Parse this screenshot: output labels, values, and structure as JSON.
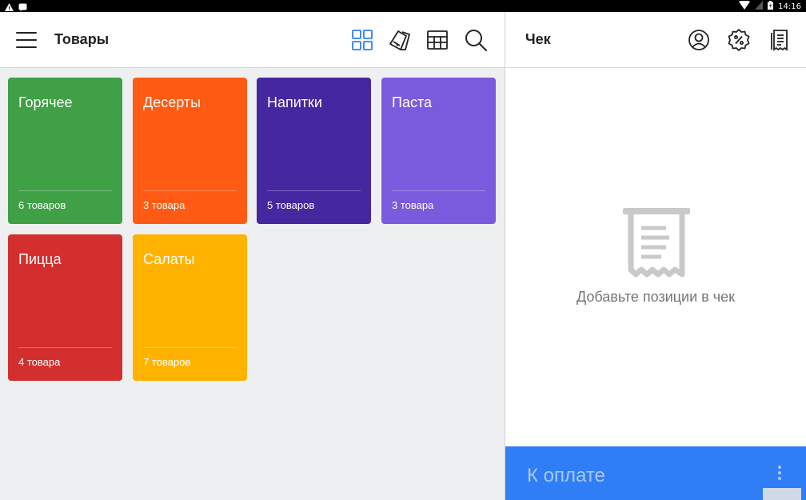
{
  "status_bar": {
    "time": "14:16"
  },
  "left": {
    "title": "Товары",
    "icons": [
      "menu-icon",
      "grid-icon",
      "palette-icon",
      "table-icon",
      "search-icon"
    ]
  },
  "categories": [
    {
      "name": "Горячее",
      "count": "6 товаров",
      "color": "#3fa046"
    },
    {
      "name": "Десерты",
      "count": "3 товара",
      "color": "#ff5b14"
    },
    {
      "name": "Напитки",
      "count": "5 товаров",
      "color": "#4527a0"
    },
    {
      "name": "Паста",
      "count": "3 товара",
      "color": "#7b5bdd"
    },
    {
      "name": "Пицца",
      "count": "4 товара",
      "color": "#d32f2f"
    },
    {
      "name": "Салаты",
      "count": "7 товаров",
      "color": "#ffb300"
    }
  ],
  "receipt": {
    "title": "Чек",
    "empty_text": "Добавьте позиции в чек",
    "pay_label": "К оплате",
    "icons": [
      "customer-icon",
      "discount-icon",
      "receipts-icon",
      "more-icon"
    ]
  },
  "colors": {
    "accent": "#2f7ef5",
    "icon_active": "#2f7ef5",
    "background": "#eeeff1"
  }
}
